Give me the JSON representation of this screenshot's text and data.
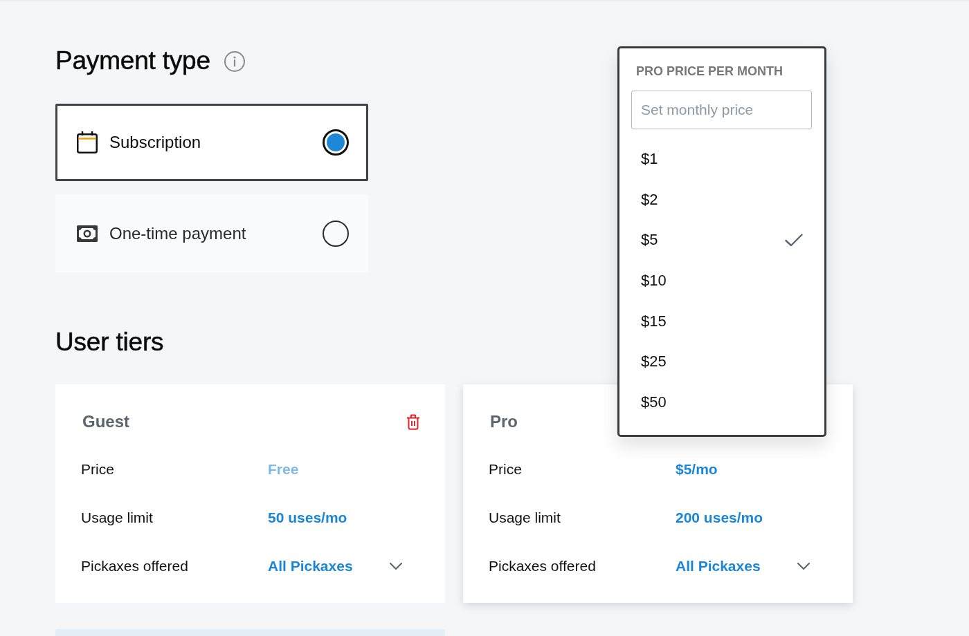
{
  "payment_type": {
    "title": "Payment type",
    "options": [
      {
        "kind": "recurring",
        "label": "Subscription",
        "selected": true
      },
      {
        "kind": "one_time",
        "label": "One-time payment",
        "selected": false
      }
    ]
  },
  "user_tiers": {
    "title": "User tiers",
    "tiers": [
      {
        "name": "Guest",
        "active": false,
        "delete_button": true,
        "rows": [
          {
            "kind": "text",
            "label": "Price",
            "value": "Free",
            "disabled": true
          },
          {
            "kind": "text",
            "label": "Usage limit",
            "value": "50 uses/mo",
            "disabled": false
          },
          {
            "kind": "dropdown",
            "label": "Pickaxes offered",
            "value": "All Pickaxes",
            "disabled": false
          }
        ]
      },
      {
        "name": "Pro",
        "active": true,
        "delete_button": false,
        "rows": [
          {
            "kind": "text",
            "label": "Price",
            "value": "$5/mo",
            "disabled": false
          },
          {
            "kind": "text",
            "label": "Usage limit",
            "value": "200 uses/mo",
            "disabled": false
          },
          {
            "kind": "dropdown",
            "label": "Pickaxes offered",
            "value": "All Pickaxes",
            "disabled": false
          }
        ]
      }
    ]
  },
  "price_menu": {
    "title": "PRO PRICE PER MONTH",
    "input": {
      "placeholder": "Set monthly price"
    },
    "options": [
      {
        "label": "$1",
        "selected": false
      },
      {
        "label": "$2",
        "selected": false
      },
      {
        "label": "$5",
        "selected": true
      },
      {
        "label": "$10",
        "selected": false
      },
      {
        "label": "$15",
        "selected": false
      },
      {
        "label": "$25",
        "selected": false
      },
      {
        "label": "$50",
        "selected": false
      }
    ]
  }
}
